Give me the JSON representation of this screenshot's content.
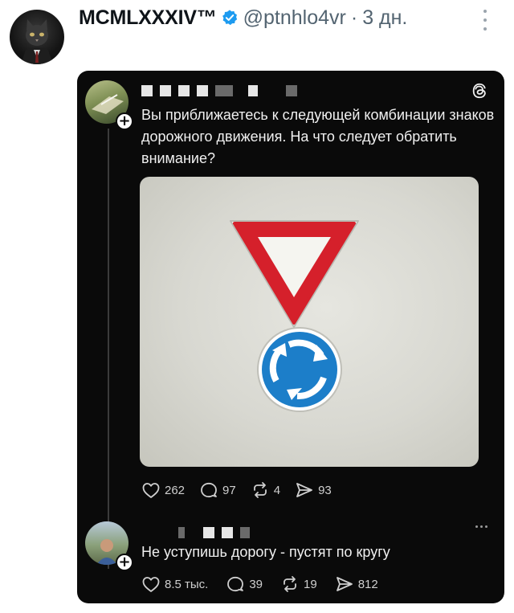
{
  "tweet": {
    "author_name": "MCMLXXXIV™",
    "author_handle": "@ptnhlo4vr",
    "separator": "·",
    "time_ago": "3 дн.",
    "avatar_icon": "cat-in-suit-avatar",
    "verified_icon": "verified-badge-icon",
    "verified_color": "#1d9bf0",
    "more_icon": "more-vertical-icon"
  },
  "threads_post": {
    "app_icon": "threads-logo-icon",
    "username_redacted": true,
    "text": "Вы приближаетесь к следующей комбинации знаков дорожного движения. На что следует обратить внимание?",
    "image": {
      "top_sign": "yield-triangle-sign",
      "bottom_sign": "roundabout-sign",
      "sign_red": "#d5202b",
      "sign_blue": "#1c7ec9"
    },
    "stats": {
      "likes": "262",
      "replies": "97",
      "reposts": "4",
      "shares": "93"
    }
  },
  "threads_reply": {
    "username_redacted": true,
    "text": "Не уступишь дорогу - пустят по кругу",
    "stats": {
      "likes": "8.5 тыс.",
      "replies": "39",
      "reposts": "19",
      "shares": "812"
    },
    "more_icon": "more-horizontal-icon"
  }
}
